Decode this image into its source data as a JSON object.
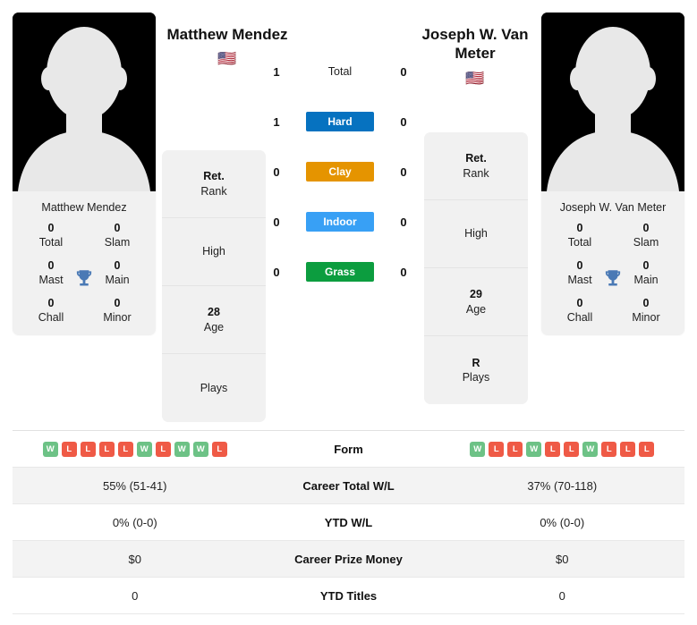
{
  "players": {
    "left": {
      "display_name": "Matthew Mendez",
      "header_name": "Matthew Mendez",
      "flag": "🇺🇸",
      "flag_name": "united-states-flag",
      "titles": [
        {
          "num": "0",
          "label": "Total"
        },
        {
          "num": "0",
          "label": "Slam"
        },
        {
          "num": "0",
          "label": "Mast"
        },
        {
          "num": "0",
          "label": "Main"
        },
        {
          "num": "0",
          "label": "Chall"
        },
        {
          "num": "0",
          "label": "Minor"
        }
      ],
      "stats": [
        {
          "value": "Ret.",
          "label": "Rank"
        },
        {
          "value": "",
          "label": "High"
        },
        {
          "value": "28",
          "label": "Age"
        },
        {
          "value": "",
          "label": "Plays"
        }
      ]
    },
    "right": {
      "display_name": "Joseph W. Van Meter",
      "header_name": "Joseph W. Van Meter",
      "flag": "🇺🇸",
      "flag_name": "united-states-flag",
      "titles": [
        {
          "num": "0",
          "label": "Total"
        },
        {
          "num": "0",
          "label": "Slam"
        },
        {
          "num": "0",
          "label": "Mast"
        },
        {
          "num": "0",
          "label": "Main"
        },
        {
          "num": "0",
          "label": "Chall"
        },
        {
          "num": "0",
          "label": "Minor"
        }
      ],
      "stats": [
        {
          "value": "Ret.",
          "label": "Rank"
        },
        {
          "value": "",
          "label": "High"
        },
        {
          "value": "29",
          "label": "Age"
        },
        {
          "value": "R",
          "label": "Plays"
        }
      ]
    }
  },
  "head_to_head": [
    {
      "surface": "Total",
      "left": "1",
      "right": "0",
      "color": ""
    },
    {
      "surface": "Hard",
      "left": "1",
      "right": "0",
      "color": "#0672c0"
    },
    {
      "surface": "Clay",
      "left": "0",
      "right": "0",
      "color": "#e59400"
    },
    {
      "surface": "Indoor",
      "left": "0",
      "right": "0",
      "color": "#38a0f5"
    },
    {
      "surface": "Grass",
      "left": "0",
      "right": "0",
      "color": "#0c9d3f"
    }
  ],
  "comparison_rows": [
    {
      "label": "Form",
      "type": "form",
      "left_form": [
        "W",
        "L",
        "L",
        "L",
        "L",
        "W",
        "L",
        "W",
        "W",
        "L"
      ],
      "right_form": [
        "W",
        "L",
        "L",
        "W",
        "L",
        "L",
        "W",
        "L",
        "L",
        "L"
      ]
    },
    {
      "label": "Career Total W/L",
      "type": "text",
      "left": "55% (51-41)",
      "right": "37% (70-118)"
    },
    {
      "label": "YTD W/L",
      "type": "text",
      "left": "0% (0-0)",
      "right": "0% (0-0)"
    },
    {
      "label": "Career Prize Money",
      "type": "text",
      "left": "$0",
      "right": "$0"
    },
    {
      "label": "YTD Titles",
      "type": "text",
      "left": "0",
      "right": "0"
    }
  ],
  "colors": {
    "win": "#6dc286",
    "loss": "#ef5a46",
    "card_bg": "#f1f1f1",
    "alt_row": "#f3f3f3"
  }
}
